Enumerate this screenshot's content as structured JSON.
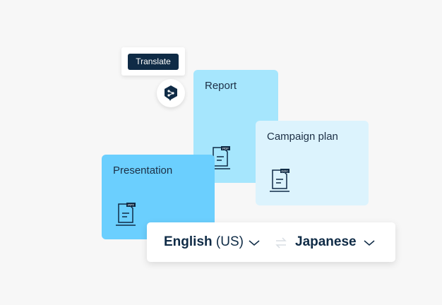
{
  "translate_popup": {
    "button_label": "Translate"
  },
  "logo": {
    "icon": "deepl-logo-icon"
  },
  "documents": [
    {
      "title": "Report",
      "file_tag": "PDF",
      "icon": "pdf-file-icon"
    },
    {
      "title": "Campaign plan",
      "file_tag": "DOC",
      "icon": "doc-file-icon"
    },
    {
      "title": "Presentation",
      "file_tag": "PPT",
      "icon": "ppt-file-icon"
    }
  ],
  "language_bar": {
    "source_bold": "English",
    "source_region": " (US)",
    "target": "Japanese",
    "swap_icon": "swap-arrows-icon",
    "dropdown_icon": "chevron-down-icon"
  },
  "colors": {
    "brand_navy": "#0f2b46",
    "report_card": "#a6e6fd",
    "campaign_card": "#dcf3fd",
    "presentation_card": "#6bcffe"
  }
}
